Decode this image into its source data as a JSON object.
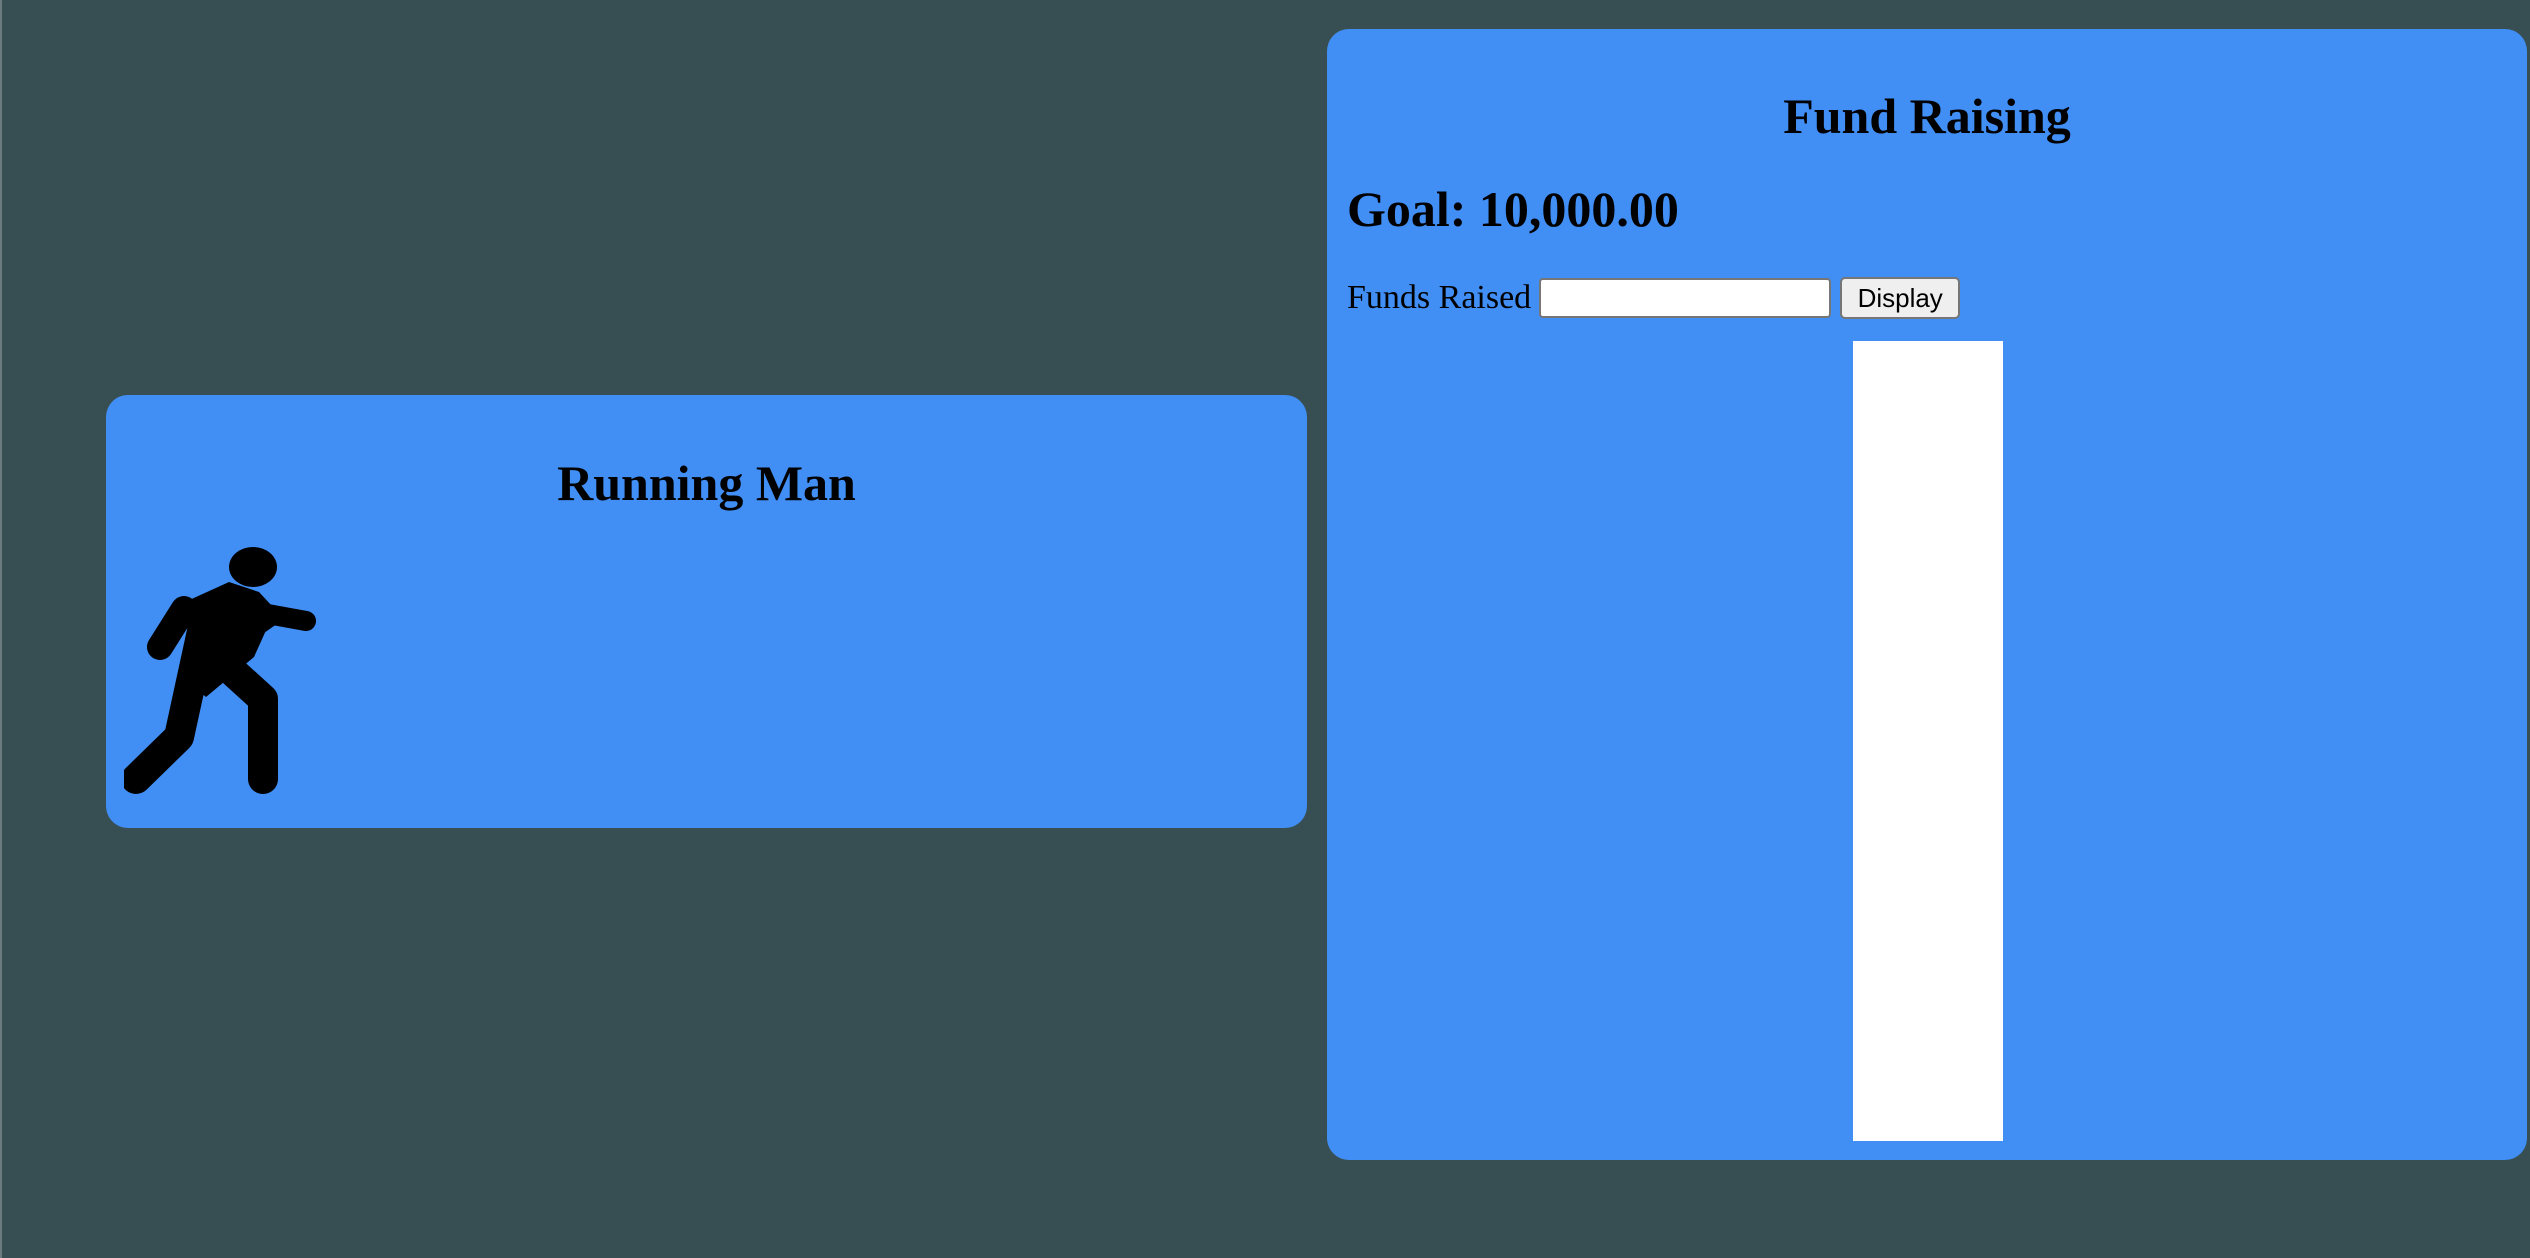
{
  "running_card": {
    "title": "Running Man",
    "icon": "walking-man-icon"
  },
  "fund_card": {
    "title": "Fund Raising",
    "goal_text": "Goal: 10,000.00",
    "funds_label": "Funds Raised",
    "funds_input_value": "",
    "display_button_label": "Display",
    "progress_fraction": 0
  },
  "colors": {
    "page_background": "#374f52",
    "card_background": "#418ef5",
    "thermometer_empty": "#ffffff"
  }
}
